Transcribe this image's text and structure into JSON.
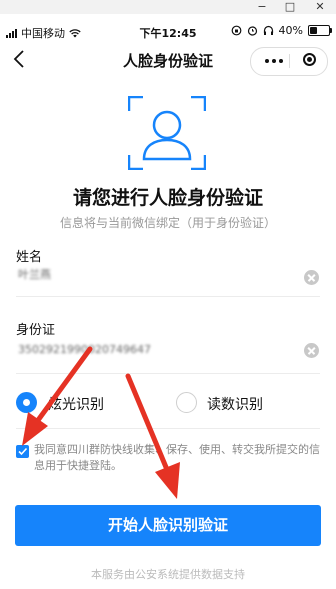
{
  "window": {
    "controls": [
      "−",
      "□",
      "✕"
    ]
  },
  "statusbar": {
    "carrier": "中国移动",
    "time": "下午12:45",
    "battery": "40%",
    "battery_level": 0.4
  },
  "nav": {
    "title": "人脸身份验证"
  },
  "page": {
    "headline": "请您进行人脸身份验证",
    "subline": "信息将与当前微信绑定（用于身份验证）"
  },
  "form": {
    "name_label": "姓名",
    "name_value": "叶兰燕",
    "id_label": "身份证",
    "id_value": "3502921990020749647"
  },
  "modes": {
    "light_label": "炫光识别",
    "number_label": "读数识别",
    "selected": "light"
  },
  "agreement": {
    "checked": true,
    "text": "我同意四川群防快线收集、保存、使用、转交我所提交的信息用于快捷登陆。"
  },
  "actions": {
    "start_label": "开始人脸识别验证"
  },
  "footer": {
    "text": "本服务由公安系统提供数据支持"
  },
  "colors": {
    "accent": "#1684fb",
    "annotation": "#e53224"
  }
}
